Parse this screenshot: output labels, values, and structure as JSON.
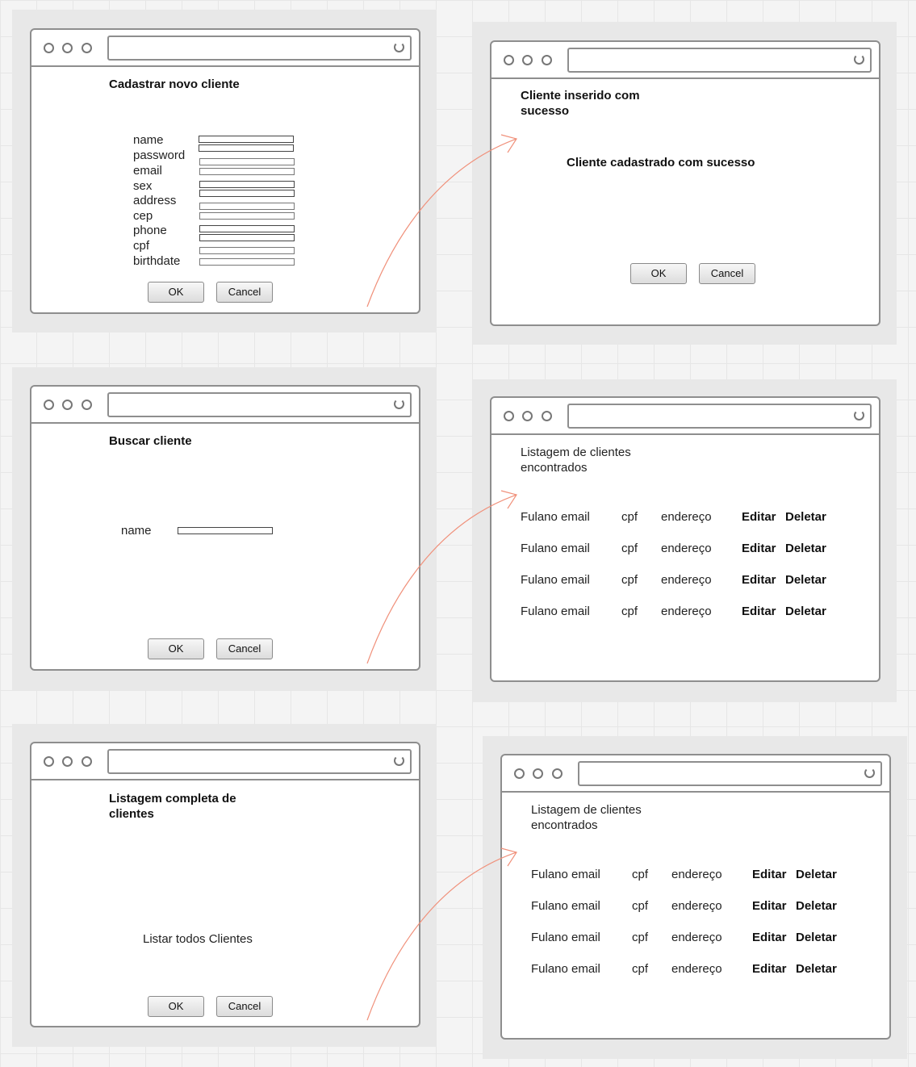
{
  "windows": {
    "cadastrar": {
      "title": "Cadastrar novo cliente",
      "fields": [
        "name",
        "password",
        "email",
        "sex",
        "address",
        "cep",
        "phone",
        "cpf",
        "birthdate"
      ],
      "ok": "OK",
      "cancel": "Cancel"
    },
    "sucesso": {
      "title_line1": "Cliente inserido com",
      "title_line2": "sucesso",
      "message": "Cliente cadastrado com sucesso",
      "ok": "OK",
      "cancel": "Cancel"
    },
    "buscar": {
      "title": "Buscar cliente",
      "field_label": "name",
      "ok": "OK",
      "cancel": "Cancel"
    },
    "resultado_busca": {
      "title_line1": "Listagem de clientes",
      "title_line2": "encontrados",
      "rows": [
        {
          "name": "Fulano",
          "email": "email",
          "cpf": "cpf",
          "address": "endereço",
          "edit": "Editar",
          "delete": "Deletar"
        },
        {
          "name": "Fulano",
          "email": "email",
          "cpf": "cpf",
          "address": "endereço",
          "edit": "Editar",
          "delete": "Deletar"
        },
        {
          "name": "Fulano",
          "email": "email",
          "cpf": "cpf",
          "address": "endereço",
          "edit": "Editar",
          "delete": "Deletar"
        },
        {
          "name": "Fulano",
          "email": "email",
          "cpf": "cpf",
          "address": "endereço",
          "edit": "Editar",
          "delete": "Deletar"
        }
      ]
    },
    "listagem": {
      "title_line1": "Listagem completa de",
      "title_line2": "clientes",
      "action_text": "Listar todos Clientes",
      "ok": "OK",
      "cancel": "Cancel"
    },
    "resultado_lista": {
      "title_line1": "Listagem de clientes",
      "title_line2": "encontrados",
      "rows": [
        {
          "name": "Fulano",
          "email": "email",
          "cpf": "cpf",
          "address": "endereço",
          "edit": "Editar",
          "delete": "Deletar"
        },
        {
          "name": "Fulano",
          "email": "email",
          "cpf": "cpf",
          "address": "endereço",
          "edit": "Editar",
          "delete": "Deletar"
        },
        {
          "name": "Fulano",
          "email": "email",
          "cpf": "cpf",
          "address": "endereço",
          "edit": "Editar",
          "delete": "Deletar"
        },
        {
          "name": "Fulano",
          "email": "email",
          "cpf": "cpf",
          "address": "endereço",
          "edit": "Editar",
          "delete": "Deletar"
        }
      ]
    }
  },
  "colors": {
    "arrow": "#f0907a",
    "panel": "#e8e8e8",
    "border": "#8e8e8e"
  }
}
